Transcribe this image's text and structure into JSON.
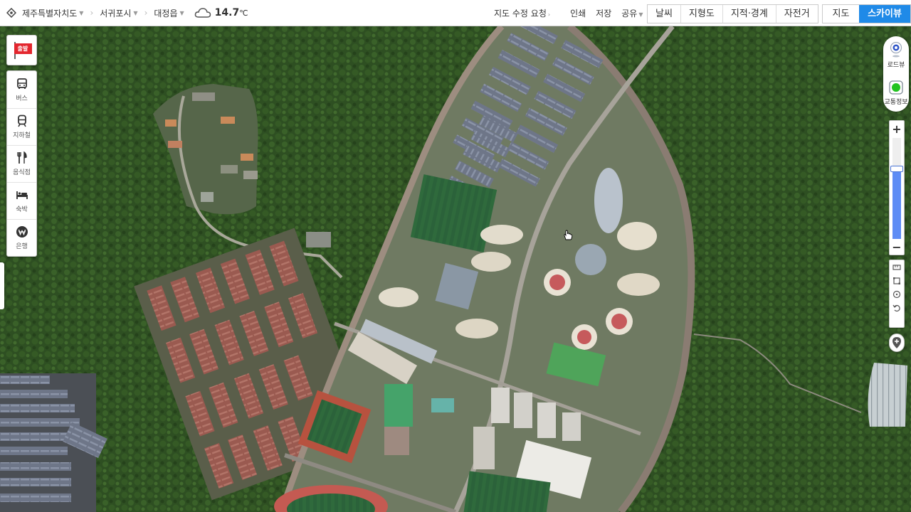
{
  "breadcrumb": {
    "items": [
      {
        "label": "제주특별자치도"
      },
      {
        "label": "서귀포시"
      },
      {
        "label": "대정읍"
      }
    ]
  },
  "weather": {
    "temperature": "14.7",
    "unit": "℃",
    "icon": "cloud-icon"
  },
  "utilities": {
    "edit_request": "지도 수정 요청",
    "print": "인쇄",
    "save": "저장",
    "share": "공유"
  },
  "overlays": [
    {
      "label": "날씨"
    },
    {
      "label": "지형도"
    },
    {
      "label": "지적·경계"
    },
    {
      "label": "자전거"
    }
  ],
  "map_types": {
    "normal": "지도",
    "skyview": "스카이뷰",
    "active": "스카이뷰"
  },
  "start_button": {
    "label": "출발"
  },
  "categories": [
    {
      "label": "버스",
      "icon": "bus-icon"
    },
    {
      "label": "지하철",
      "icon": "subway-icon"
    },
    {
      "label": "음식점",
      "icon": "restaurant-icon"
    },
    {
      "label": "숙박",
      "icon": "bed-icon"
    },
    {
      "label": "은행",
      "icon": "bank-icon"
    }
  ],
  "right_controls": {
    "roadview": "로드뷰",
    "traffic": "교통정보"
  },
  "zoom": {
    "level_fraction": 0.7
  },
  "colors": {
    "accent": "#1f8ae8",
    "zoom_fill": "#5e8cf5",
    "flag": "#e3262e",
    "traffic_green": "#22c31f"
  }
}
